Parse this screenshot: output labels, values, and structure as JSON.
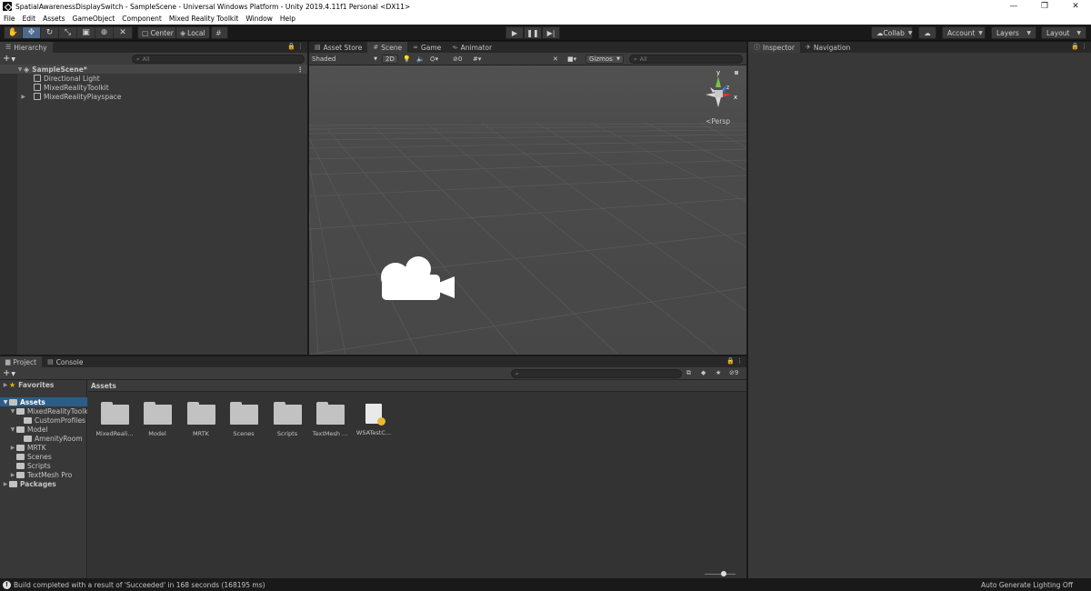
{
  "window": {
    "title": "SpatialAwarenessDisplaySwitch - SampleScene - Universal Windows Platform - Unity 2019.4.11f1 Personal <DX11>",
    "minimize": "—",
    "restore": "❐",
    "close": "✕"
  },
  "menu": [
    "File",
    "Edit",
    "Assets",
    "GameObject",
    "Component",
    "Mixed Reality Toolkit",
    "Window",
    "Help"
  ],
  "toolbar": {
    "tools": [
      "hand-icon",
      "move-icon",
      "rotate-icon",
      "scale-icon",
      "rect-icon",
      "transform-icon",
      "custom-tool-icon"
    ],
    "pivot_label": "Center",
    "space_label": "Local",
    "collab_label": "Collab",
    "account_label": "Account",
    "layers_label": "Layers",
    "layout_label": "Layout"
  },
  "hierarchy": {
    "tab_label": "Hierarchy",
    "search_placeholder": "All",
    "scene_name": "SampleScene*",
    "items": [
      "Directional Light",
      "MixedRealityToolkit",
      "MixedRealityPlayspace"
    ]
  },
  "scene": {
    "tabs": [
      "Asset Store",
      "Scene",
      "Game",
      "Animator"
    ],
    "shading_mode": "Shaded",
    "mode_2d": "2D",
    "hidden_count": "0",
    "gizmos_label": "Gizmos",
    "search_placeholder": "All",
    "persp_label": "Persp",
    "axis_labels": {
      "y": "y",
      "x": "x",
      "z": "z"
    }
  },
  "inspector": {
    "tabs": [
      "Inspector",
      "Navigation"
    ]
  },
  "project": {
    "tabs": [
      "Project",
      "Console"
    ],
    "hidden_count": "9",
    "favorites_label": "Favorites",
    "tree": {
      "assets_label": "Assets",
      "children": [
        "MixedRealityToolk",
        "CustomProfiles",
        "Model",
        "AmenityRoom",
        "MRTK",
        "Scenes",
        "Scripts",
        "TextMesh Pro"
      ],
      "packages_label": "Packages"
    },
    "breadcrumb": "Assets",
    "assets": [
      {
        "label": "MixedReali...",
        "kind": "folder"
      },
      {
        "label": "Model",
        "kind": "folder"
      },
      {
        "label": "MRTK",
        "kind": "folder"
      },
      {
        "label": "Scenes",
        "kind": "folder"
      },
      {
        "label": "Scripts",
        "kind": "folder"
      },
      {
        "label": "TextMesh ...",
        "kind": "folder"
      },
      {
        "label": "WSATestC...",
        "kind": "script"
      }
    ]
  },
  "status": {
    "message": "Build completed with a result of 'Succeeded' in 168 seconds (168195 ms)",
    "right": "Auto Generate Lighting Off"
  }
}
